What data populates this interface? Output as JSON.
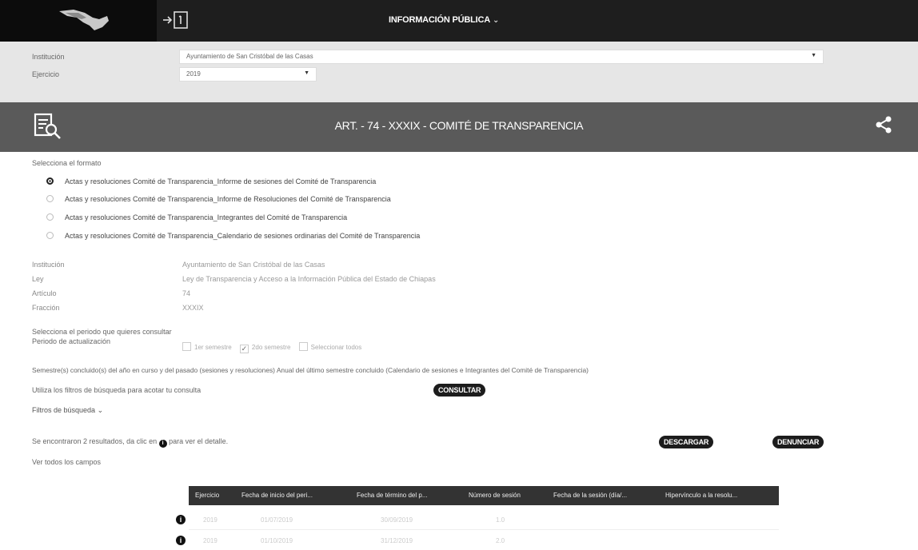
{
  "header": {
    "menu_label": "INFORMACIÓN PÚBLICA",
    "menu_chevron": "⌄"
  },
  "filters": {
    "institucion_label": "Institución",
    "institucion_value": "Ayuntamiento de San Cristóbal de las Casas",
    "ejercicio_label": "Ejercicio",
    "ejercicio_value": "2019"
  },
  "section": {
    "title": "ART. - 74 - XXXIX - COMITÉ DE TRANSPARENCIA"
  },
  "format": {
    "prompt": "Selecciona el formato",
    "options": [
      {
        "label": "Actas y resoluciones Comité de Transparencia_Informe de sesiones del Comité de Transparencia",
        "selected": true
      },
      {
        "label": "Actas y resoluciones Comité de Transparencia_Informe de Resoluciones del Comité de Transparencia",
        "selected": false
      },
      {
        "label": "Actas y resoluciones Comité de Transparencia_Integrantes del Comité de Transparencia",
        "selected": false
      },
      {
        "label": "Actas y resoluciones Comité de Transparencia_Calendario de sesiones ordinarias del Comité de Transparencia",
        "selected": false
      }
    ]
  },
  "meta": {
    "institucion_label": "Institución",
    "institucion_value": "Ayuntamiento de San Cristóbal de las Casas",
    "ley_label": "Ley",
    "ley_value": "Ley de Transparencia y Acceso a la Información Pública del Estado de Chiapas",
    "articulo_label": "Artículo",
    "articulo_value": "74",
    "fraccion_label": "Fracción",
    "fraccion_value": "XXXIX"
  },
  "period": {
    "prompt": "Selecciona el periodo que quieres consultar",
    "label": "Periodo de actualización",
    "options": [
      {
        "label": "1er semestre",
        "checked": false
      },
      {
        "label": "2do semestre",
        "checked": true
      },
      {
        "label": "Seleccionar todos",
        "checked": false
      }
    ],
    "note": "Semestre(s) concluido(s) del año en curso y del pasado (sesiones y resoluciones) Anual del último semestre concluido (Calendario de sesiones e Integrantes del Comité de Transparencia)"
  },
  "search": {
    "hint": "Utiliza los filtros de búsqueda para acotar tu consulta",
    "consultar_label": "CONSULTAR",
    "filters_toggle": "Filtros de búsqueda",
    "filters_chevron": "⌄"
  },
  "results": {
    "summary_before": "Se encontraron 2 resultados, da clic en",
    "summary_icon": "i",
    "summary_after": "para ver el detalle.",
    "show_all": "Ver todos los campos",
    "download_label": "DESCARGAR",
    "report_label": "DENUNCIAR"
  },
  "table": {
    "columns": [
      "Ejercicio",
      "Fecha de inicio del peri...",
      "Fecha de término del p...",
      "Número de sesión",
      "Fecha de la sesión (día/...",
      "Hipervínculo a la resolu..."
    ],
    "rows": [
      [
        "2019",
        "01/07/2019",
        "30/09/2019",
        "1.0"
      ],
      [
        "2019",
        "01/10/2019",
        "31/12/2019",
        "2.0"
      ]
    ]
  },
  "colors": {
    "topbar": "#1e1e1e",
    "section_bar": "#5a5a5a",
    "filter_band": "#e6e6e6",
    "button": "#1c1c1c"
  }
}
